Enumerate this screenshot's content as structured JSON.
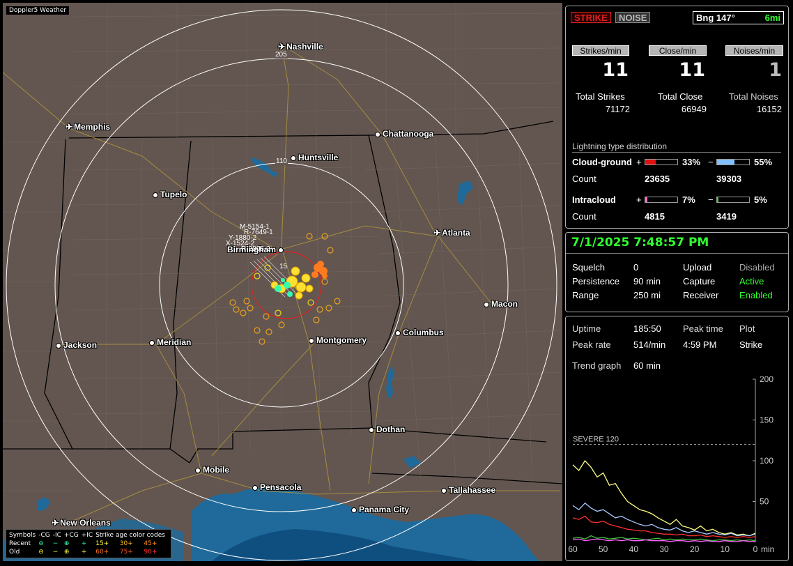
{
  "app_title": "Doppler5 Weather",
  "map": {
    "cities": [
      {
        "name": "Nashville",
        "icon": "plane-icon"
      },
      {
        "name": "Memphis",
        "icon": "plane-icon"
      },
      {
        "name": "Chattanooga",
        "icon": "city-dot-icon"
      },
      {
        "name": "Huntsville",
        "icon": "city-dot-icon"
      },
      {
        "name": "Tupelo",
        "icon": "city-dot-icon"
      },
      {
        "name": "Atlanta",
        "icon": "plane-icon"
      },
      {
        "name": "Birmingham",
        "icon": "city-dot-icon"
      },
      {
        "name": "Macon",
        "icon": "city-dot-icon"
      },
      {
        "name": "Columbus",
        "icon": "city-dot-icon"
      },
      {
        "name": "Montgomery",
        "icon": "city-dot-icon"
      },
      {
        "name": "Jackson",
        "icon": "city-dot-icon"
      },
      {
        "name": "Meridian",
        "icon": "city-dot-icon"
      },
      {
        "name": "Dothan",
        "icon": "city-dot-icon"
      },
      {
        "name": "Mobile",
        "icon": "city-dot-icon"
      },
      {
        "name": "Pensacola",
        "icon": "city-dot-icon"
      },
      {
        "name": "Tallahassee",
        "icon": "city-dot-icon"
      },
      {
        "name": "Panama City",
        "icon": "city-dot-icon"
      },
      {
        "name": "New Orleans",
        "icon": "plane-icon"
      }
    ],
    "range_labels": [
      "205",
      "110",
      "15"
    ],
    "storm_labels": [
      "M-5154-1",
      "R-7649-1",
      "Y-1880-2",
      "X-1524-2",
      "R-2806-2"
    ],
    "legend": {
      "symbols_label": "Symbols",
      "cols": [
        "-CG",
        "-IC",
        "+CG",
        "+IC"
      ],
      "age_label": "Strike age color codes",
      "recent_label": "Recent",
      "old_label": "Old",
      "recent_ages": [
        "15+",
        "30+",
        "45+"
      ],
      "old_ages": [
        "60+",
        "75+",
        "90+"
      ],
      "recent_symbols": [
        "⊖",
        "−",
        "⊕",
        "+"
      ],
      "old_symbols": [
        "⊖",
        "−",
        "⊕",
        "+"
      ]
    }
  },
  "panel1": {
    "strike_btn": "STRIKE",
    "noise_btn": "NOISE",
    "bearing": "Bng 147°",
    "distance": "6mi",
    "hdr_strikes": "Strikes/min",
    "hdr_close": "Close/min",
    "hdr_noises": "Noises/min",
    "strikes_min": "11",
    "close_min": "11",
    "noises_min": "1",
    "lbl_total_strikes": "Total Strikes",
    "lbl_total_close": "Total Close",
    "lbl_total_noises": "Total Noises",
    "total_strikes": "71172",
    "total_close": "66949",
    "total_noises": "16152",
    "dist_title": "Lightning type distribution",
    "cg_label": "Cloud-ground",
    "ic_label": "Intracloud",
    "count_label": "Count",
    "plus": "+",
    "minus": "−",
    "cg_pos_pct": "33%",
    "cg_neg_pct": "55%",
    "ic_pos_pct": "7%",
    "ic_neg_pct": "5%",
    "cg_pos_val": 33,
    "cg_neg_val": 55,
    "ic_pos_val": 7,
    "ic_neg_val": 5,
    "cg_pos_count": "23635",
    "cg_neg_count": "39303",
    "ic_pos_count": "4815",
    "ic_neg_count": "3419"
  },
  "panel2": {
    "datetime": "7/1/2025 7:48:57 PM",
    "squelch_l": "Squelch",
    "squelch_v": "0",
    "persist_l": "Persistence",
    "persist_v": "90 min",
    "range_l": "Range",
    "range_v": "250 mi",
    "upload_l": "Upload",
    "upload_v": "Disabled",
    "capture_l": "Capture",
    "capture_v": "Active",
    "receiver_l": "Receiver",
    "receiver_v": "Enabled"
  },
  "panel3": {
    "uptime_l": "Uptime",
    "uptime_v": "185:50",
    "peak_time_l": "Peak time",
    "peak_time_v": "4:59 PM",
    "plot_l": "Plot",
    "plot_v": "Strike",
    "peak_rate_l": "Peak rate",
    "peak_rate_v": "514/min",
    "trend_l": "Trend graph",
    "trend_v": "60 min",
    "severe": "SEVERE 120",
    "y_ticks": [
      "200",
      "150",
      "100",
      "50"
    ],
    "x_ticks": [
      "60",
      "50",
      "40",
      "30",
      "20",
      "10",
      "0"
    ],
    "x_unit": "min"
  },
  "chart_data": {
    "type": "line",
    "x": [
      60,
      58,
      56,
      54,
      52,
      50,
      48,
      46,
      44,
      42,
      40,
      38,
      36,
      34,
      32,
      30,
      28,
      26,
      24,
      22,
      20,
      18,
      16,
      14,
      12,
      10,
      8,
      6,
      4,
      2,
      0
    ],
    "ylim": [
      0,
      200
    ],
    "xlim": [
      60,
      0
    ],
    "severe_threshold": 120,
    "series": [
      {
        "color": "#ffff80",
        "values": [
          95,
          88,
          100,
          92,
          80,
          85,
          70,
          72,
          60,
          50,
          45,
          40,
          38,
          35,
          30,
          26,
          22,
          28,
          20,
          18,
          15,
          20,
          14,
          16,
          12,
          10,
          12,
          9,
          10,
          8,
          11
        ]
      },
      {
        "color": "#a8c8ff",
        "values": [
          45,
          40,
          48,
          42,
          38,
          40,
          35,
          30,
          32,
          28,
          25,
          22,
          20,
          22,
          18,
          16,
          15,
          18,
          14,
          12,
          14,
          12,
          10,
          12,
          10,
          9,
          11,
          8,
          9,
          8,
          10
        ]
      },
      {
        "color": "#ff3030",
        "values": [
          30,
          28,
          32,
          25,
          24,
          26,
          22,
          20,
          18,
          16,
          15,
          14,
          14,
          12,
          11,
          10,
          10,
          9,
          10,
          8,
          8,
          9,
          7,
          8,
          7,
          6,
          7,
          6,
          7,
          6,
          7
        ]
      },
      {
        "color": "#40c040",
        "values": [
          5,
          6,
          4,
          8,
          5,
          6,
          4,
          5,
          6,
          4,
          5,
          4,
          3,
          4,
          5,
          3,
          4,
          3,
          4,
          3,
          3,
          4,
          3,
          2,
          3,
          3,
          2,
          3,
          2,
          3,
          2
        ]
      },
      {
        "color": "#ff60ff",
        "values": [
          3,
          4,
          2,
          3,
          4,
          3,
          2,
          3,
          2,
          3,
          2,
          2,
          3,
          2,
          2,
          2,
          1,
          2,
          2,
          1,
          2,
          1,
          2,
          1,
          1,
          2,
          1,
          1,
          2,
          1,
          1
        ]
      }
    ]
  }
}
